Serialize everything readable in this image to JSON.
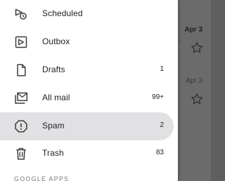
{
  "background_list": {
    "dates": [
      "Apr 3",
      "Apr 3"
    ]
  },
  "drawer": {
    "items": [
      {
        "label": "Scheduled",
        "count": "",
        "icon": "scheduled-icon"
      },
      {
        "label": "Outbox",
        "count": "",
        "icon": "outbox-icon"
      },
      {
        "label": "Drafts",
        "count": "1",
        "icon": "drafts-icon"
      },
      {
        "label": "All mail",
        "count": "99+",
        "icon": "all-mail-icon"
      },
      {
        "label": "Spam",
        "count": "2",
        "icon": "spam-icon",
        "selected": true
      },
      {
        "label": "Trash",
        "count": "83",
        "icon": "trash-icon"
      }
    ],
    "section_header": "GOOGLE APPS"
  },
  "colors": {
    "selected_bg": "#e1e1e3",
    "text": "#202124",
    "scrim": "#6b6b6b"
  }
}
